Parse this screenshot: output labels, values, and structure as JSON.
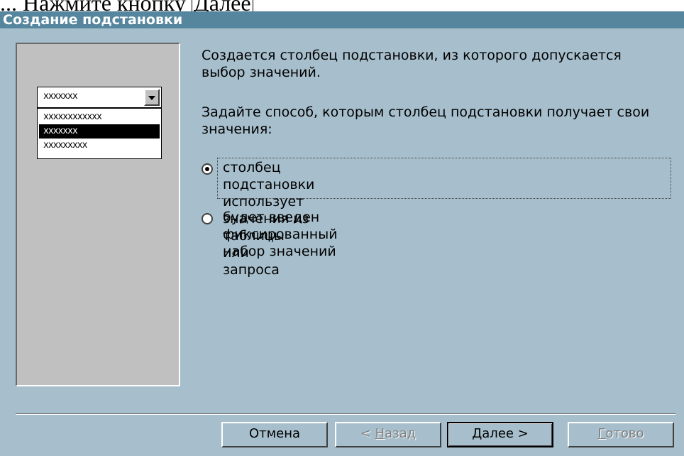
{
  "document_caption": {
    "before": "... Нажмите кнопку ",
    "boxed": "Далее"
  },
  "window": {
    "title": "Создание подстановки"
  },
  "preview": {
    "combo_value": "xxxxxxx",
    "list_items": [
      "xxxxxxxxxxxx",
      "xxxxxxx",
      "xxxxxxxxx"
    ],
    "selected_index": 1
  },
  "body": {
    "intro_line1": "Создается столбец подстановки, из которого допускается",
    "intro_line2": "выбор значений.",
    "prompt_line1": "Задайте способ, которым столбец подстановки получает свои",
    "prompt_line2": "значения:"
  },
  "options": [
    {
      "line1": "столбец подстановки использует значения из таблицы или",
      "line2": "запроса",
      "checked": true
    },
    {
      "line1": "будет введен фиксированный набор значений",
      "line2": "",
      "checked": false
    }
  ],
  "buttons": {
    "cancel": "Отмена",
    "back_prefix": "< ",
    "back_accel": "Н",
    "back_rest": "азад",
    "next_accel": "Д",
    "next_rest": "алее >",
    "finish_accel": "Г",
    "finish_rest": "отово"
  },
  "colors": {
    "dialog_bg": "#a7bfcc",
    "titlebar": "#55869e",
    "preview_bg": "#c0c0c0"
  }
}
